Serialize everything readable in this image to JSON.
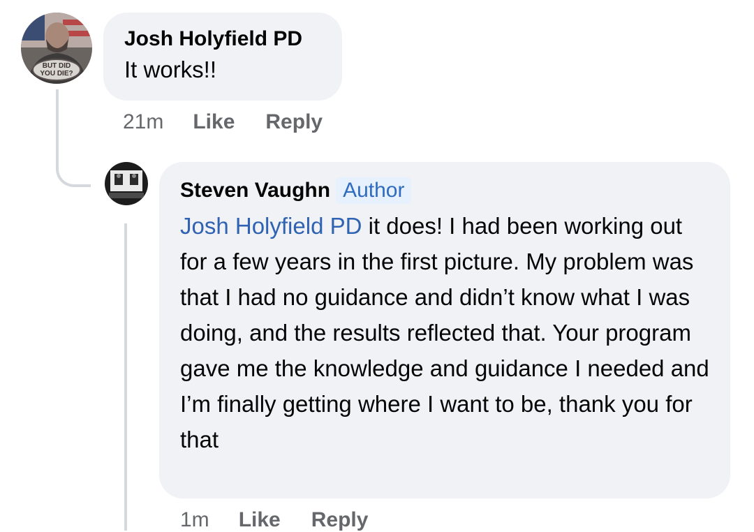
{
  "comments": [
    {
      "author": "Josh Holyfield PD",
      "text": "It works!!",
      "time": "21m",
      "like_label": "Like",
      "reply_label": "Reply",
      "avatar_caption": "BUT DID YOU DIE?"
    },
    {
      "author": "Steven Vaughn",
      "badge": "Author",
      "mention": "Josh Holyfield PD",
      "text": " it does! I had been working out for a few years in the first picture. My problem was that I had no guidance and didn’t know what I was doing, and the results reflected that. Your program gave me the knowledge and guidance I needed and I’m finally getting where I want to be, thank you for that",
      "time": "1m",
      "like_label": "Like",
      "reply_label": "Reply"
    }
  ],
  "colors": {
    "bubble_bg": "#f0f2f5",
    "mention": "#2f62b2",
    "badge_bg": "#e7f0fd",
    "badge_text": "#2f6bbf",
    "meta_text": "#65676b"
  }
}
